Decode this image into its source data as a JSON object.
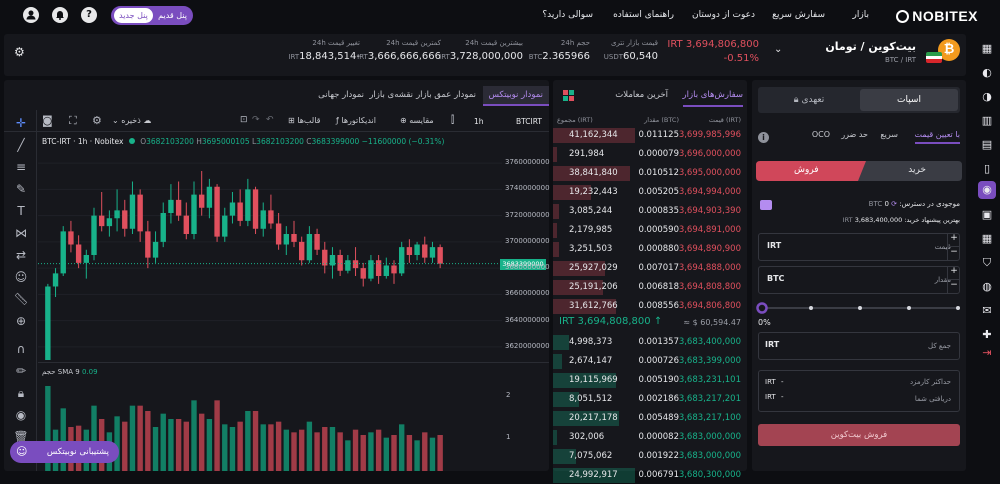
{
  "nav": {
    "brand": "NOBITEX",
    "links": [
      "بازار",
      "سفارش سریع",
      "دعوت از دوستان",
      "راهنمای استفاده",
      "سوالی دارید؟"
    ],
    "old_panel": "پنل قدیم",
    "new_panel": "پنل جدید"
  },
  "ticker": {
    "title": "بیت‌کوین / تومان",
    "pair": "BTC / IRT",
    "price": "IRT 3,694,806,800",
    "change": "-0.51%",
    "stats": [
      {
        "label": "قیمت بازار تتری",
        "value": "60,540",
        "cur": "USDT"
      },
      {
        "label": "حجم 24h",
        "value": "2.365966",
        "cur": "BTC"
      },
      {
        "label": "بیشترین قیمت 24h",
        "value": "3,728,000,000",
        "cur": "IRT"
      },
      {
        "label": "کمترین قیمت 24h",
        "value": "3,666,666,666",
        "cur": "IRT"
      },
      {
        "label": "تغییر قیمت 24h",
        "value": "18,843,514-",
        "cur": "IRT"
      }
    ]
  },
  "trade": {
    "tab_spot": "اسپات",
    "tab_margin": "تعهدی",
    "order_types": [
      "با تعیین قیمت",
      "سریع",
      "حد ضرر",
      "OCO"
    ],
    "buy": "خرید",
    "sell": "فروش",
    "available_label": "موجودی در دسترس:",
    "available_value": "0",
    "available_cur": "BTC",
    "best_buy_label": "بهترین پیشنهاد خرید:",
    "best_buy_value": "3,683,400,000",
    "best_buy_cur": "IRT",
    "price_label": "قیمت",
    "price_cur": "IRT",
    "amount_label": "مقدار",
    "amount_cur": "BTC",
    "slider_pct": "0%",
    "total_label": "جمع کل",
    "total_cur": "IRT",
    "fee_label": "حداکثر کارمزد",
    "fee_cur": "IRT",
    "fee_val": "-",
    "recv_label": "دریافتی شما",
    "recv_cur": "IRT",
    "recv_val": "-",
    "submit": "فروش بیت‌کوین"
  },
  "orderbook": {
    "tab_orders": "سفارش‌های بازار",
    "tab_trades": "آخرین معاملات",
    "headers": [
      "قیمت (IRT)",
      "مقدار (BTC)",
      "مجموع (IRT)"
    ],
    "asks": [
      [
        "3,699,985,996",
        "0.011125",
        "41,162,344"
      ],
      [
        "3,696,000,000",
        "0.000079",
        "291,984"
      ],
      [
        "3,695,000,000",
        "0.010512",
        "38,841,840"
      ],
      [
        "3,694,994,000",
        "0.005205",
        "19,232,443"
      ],
      [
        "3,694,903,390",
        "0.000835",
        "3,085,244"
      ],
      [
        "3,694,891,000",
        "0.000590",
        "2,179,985"
      ],
      [
        "3,694,890,900",
        "0.000880",
        "3,251,503"
      ],
      [
        "3,694,888,000",
        "0.007017",
        "25,927,029"
      ],
      [
        "3,694,808,800",
        "0.006818",
        "25,191,206"
      ],
      [
        "3,694,806,800",
        "0.008556",
        "31,612,766"
      ]
    ],
    "mid_price": "IRT 3,694,808,800",
    "mid_arrow": "↑",
    "mid_usd": "≈ $ 60,594.47",
    "bids": [
      [
        "3,683,400,000",
        "0.001357",
        "4,998,373"
      ],
      [
        "3,683,399,000",
        "0.000726",
        "2,674,147"
      ],
      [
        "3,683,231,101",
        "0.005190",
        "19,115,969"
      ],
      [
        "3,683,217,201",
        "0.002186",
        "8,051,512"
      ],
      [
        "3,683,217,100",
        "0.005489",
        "20,217,178"
      ],
      [
        "3,683,000,000",
        "0.000082",
        "302,006"
      ],
      [
        "3,683,000,000",
        "0.001922",
        "7,075,062"
      ],
      [
        "3,680,300,000",
        "0.006791",
        "24,992,917"
      ]
    ]
  },
  "chart": {
    "tabs": [
      "نمودار نوبیتکس",
      "نمودار عمق بازار",
      "نقشه‌ی بازار",
      "نمودار جهانی"
    ],
    "symbol": "BTCIRT",
    "interval": "1h",
    "compare": "مقایسه",
    "indicators": "اندیکاتورها",
    "templates": "قالب‌ها",
    "save": "ذخیره",
    "legend": {
      "name": "BTC-IRT · 1h · Nobitex",
      "O": "3682103200",
      "H": "3695000105",
      "L": "3682103200",
      "C": "3683399000",
      "chg": "−11600000 (−0.31%)"
    },
    "yticks": [
      "3760000000",
      "3740000000",
      "3720000000",
      "3700000000",
      "3680000000",
      "3660000000",
      "3640000000",
      "3620000000"
    ],
    "last_price": "3683399000",
    "vol_label": "حجم",
    "vol_ma": "SMA 9",
    "vol_ma_val": "0.09",
    "vol_ticks": [
      "2",
      "1"
    ]
  },
  "support": "پشتیبانی نوبیتکس",
  "colors": {
    "green": "#18b28a",
    "red": "#e0505e",
    "purple": "#7a4dbf"
  },
  "chart_data": {
    "type": "candlestick",
    "title": "BTC-IRT · 1h · Nobitex",
    "ylim": [
      3610000000,
      3770000000
    ],
    "series": [
      {
        "name": "BTC-IRT",
        "ohlc": [
          [
            3600000000,
            3668000000,
            3605000000,
            3666000000
          ],
          [
            3666000000,
            3680000000,
            3658000000,
            3676000000
          ],
          [
            3676000000,
            3712000000,
            3674000000,
            3708000000
          ],
          [
            3708000000,
            3716000000,
            3692000000,
            3698000000
          ],
          [
            3698000000,
            3705000000,
            3680000000,
            3684000000
          ],
          [
            3684000000,
            3694000000,
            3672000000,
            3690000000
          ],
          [
            3690000000,
            3726000000,
            3686000000,
            3720000000
          ],
          [
            3720000000,
            3738000000,
            3708000000,
            3712000000
          ],
          [
            3712000000,
            3724000000,
            3704000000,
            3718000000
          ],
          [
            3718000000,
            3740000000,
            3708000000,
            3724000000
          ],
          [
            3724000000,
            3732000000,
            3704000000,
            3710000000
          ],
          [
            3710000000,
            3746000000,
            3706000000,
            3736000000
          ],
          [
            3736000000,
            3740000000,
            3700000000,
            3708000000
          ],
          [
            3708000000,
            3716000000,
            3680000000,
            3688000000
          ],
          [
            3688000000,
            3708000000,
            3684000000,
            3700000000
          ],
          [
            3700000000,
            3730000000,
            3696000000,
            3722000000
          ],
          [
            3722000000,
            3744000000,
            3714000000,
            3732000000
          ],
          [
            3732000000,
            3746000000,
            3716000000,
            3720000000
          ],
          [
            3720000000,
            3730000000,
            3702000000,
            3706000000
          ],
          [
            3706000000,
            3746000000,
            3702000000,
            3736000000
          ],
          [
            3736000000,
            3754000000,
            3720000000,
            3726000000
          ],
          [
            3726000000,
            3748000000,
            3718000000,
            3742000000
          ],
          [
            3742000000,
            3744000000,
            3700000000,
            3704000000
          ],
          [
            3704000000,
            3726000000,
            3700000000,
            3720000000
          ],
          [
            3720000000,
            3738000000,
            3714000000,
            3730000000
          ],
          [
            3730000000,
            3740000000,
            3712000000,
            3716000000
          ],
          [
            3716000000,
            3748000000,
            3712000000,
            3740000000
          ],
          [
            3740000000,
            3742000000,
            3706000000,
            3710000000
          ],
          [
            3710000000,
            3730000000,
            3704000000,
            3724000000
          ],
          [
            3724000000,
            3736000000,
            3710000000,
            3714000000
          ],
          [
            3714000000,
            3722000000,
            3694000000,
            3698000000
          ],
          [
            3698000000,
            3712000000,
            3690000000,
            3706000000
          ],
          [
            3706000000,
            3716000000,
            3696000000,
            3700000000
          ],
          [
            3700000000,
            3704000000,
            3682000000,
            3686000000
          ],
          [
            3686000000,
            3712000000,
            3684000000,
            3706000000
          ],
          [
            3706000000,
            3710000000,
            3690000000,
            3694000000
          ],
          [
            3694000000,
            3700000000,
            3676000000,
            3682000000
          ],
          [
            3682000000,
            3696000000,
            3672000000,
            3690000000
          ],
          [
            3690000000,
            3694000000,
            3674000000,
            3678000000
          ],
          [
            3678000000,
            3690000000,
            3676000000,
            3686000000
          ],
          [
            3686000000,
            3696000000,
            3674000000,
            3680000000
          ],
          [
            3680000000,
            3684000000,
            3666000000,
            3672000000
          ],
          [
            3672000000,
            3690000000,
            3670000000,
            3686000000
          ],
          [
            3686000000,
            3690000000,
            3668000000,
            3674000000
          ],
          [
            3674000000,
            3688000000,
            3672000000,
            3682000000
          ],
          [
            3682000000,
            3686000000,
            3668000000,
            3676000000
          ],
          [
            3676000000,
            3700000000,
            3674000000,
            3696000000
          ],
          [
            3696000000,
            3702000000,
            3684000000,
            3690000000
          ],
          [
            3690000000,
            3700000000,
            3686000000,
            3698000000
          ],
          [
            3698000000,
            3704000000,
            3684000000,
            3688000000
          ],
          [
            3688000000,
            3700000000,
            3684000000,
            3696000000
          ],
          [
            3696000000,
            3698000000,
            3680000000,
            3683399000
          ]
        ]
      }
    ]
  }
}
